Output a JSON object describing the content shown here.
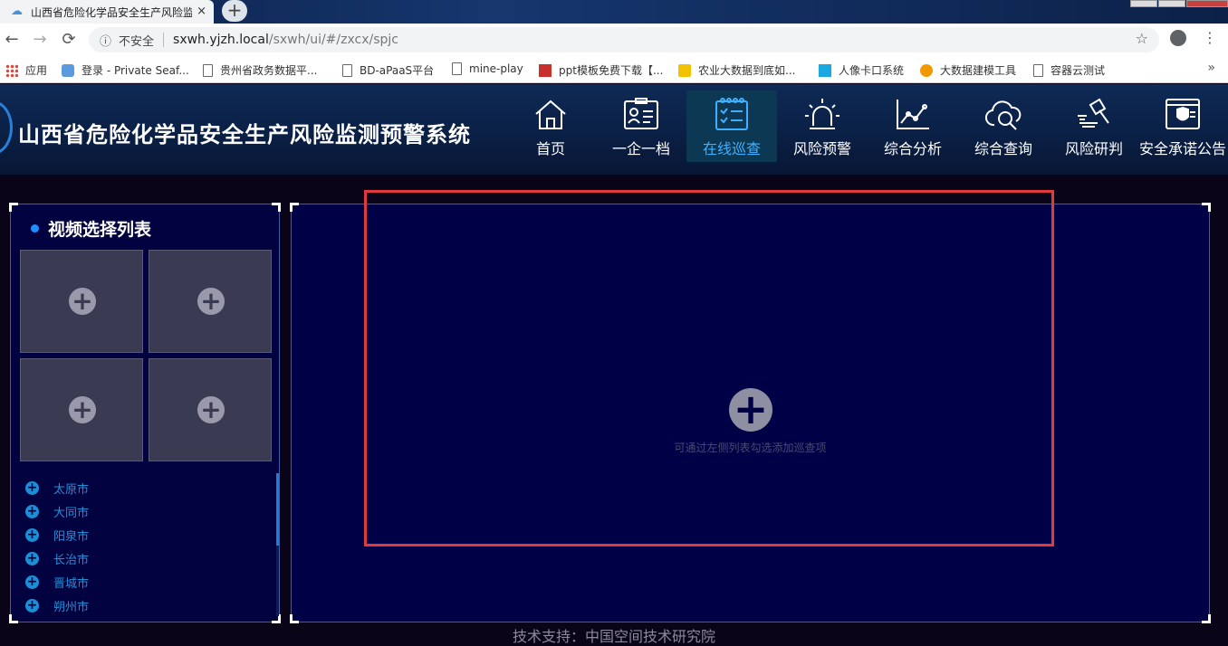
{
  "browser": {
    "tab_title": "山西省危险化学品安全生产风险监测",
    "tab_close": "×",
    "newtab": "+",
    "back": "←",
    "forward": "→",
    "reload": "⟳",
    "info_glyph": "ⓘ",
    "insecure": "不安全",
    "url_host": "sxwh.yjzh.local",
    "url_path": "/sxwh/ui/#/zxcx/spjc",
    "star": "☆",
    "menu": "⋮",
    "bookmarks_more": "»",
    "bookmarks": [
      {
        "label": "应用",
        "icon": "apps-grid-icon"
      },
      {
        "label": "登录 - Private Seaf...",
        "icon": "seafile-icon"
      },
      {
        "label": "贵州省政务数据平...",
        "icon": "page-icon"
      },
      {
        "label": "BD-aPaaS平台",
        "icon": "page-icon"
      },
      {
        "label": "mine-play",
        "icon": "page-icon"
      },
      {
        "label": "ppt模板免费下载【...",
        "icon": "ppt-icon"
      },
      {
        "label": "农业大数据到底如...",
        "icon": "sohu-icon"
      },
      {
        "label": "人像卡口系统",
        "icon": "camera-icon"
      },
      {
        "label": "大数据建模工具",
        "icon": "cloud-icon"
      },
      {
        "label": "容器云测试",
        "icon": "page-icon"
      }
    ]
  },
  "app": {
    "title": "山西省危险化学品安全生产风险监测预警系统",
    "nav": [
      {
        "label": "首页",
        "icon": "home-icon",
        "active": false
      },
      {
        "label": "一企一档",
        "icon": "id-card-icon",
        "active": false
      },
      {
        "label": "在线巡查",
        "icon": "checklist-icon",
        "active": true
      },
      {
        "label": "风险预警",
        "icon": "alarm-light-icon",
        "active": false
      },
      {
        "label": "综合分析",
        "icon": "line-chart-icon",
        "active": false
      },
      {
        "label": "综合查询",
        "icon": "cloud-search-icon",
        "active": false
      },
      {
        "label": "风险研判",
        "icon": "gavel-icon",
        "active": false
      },
      {
        "label": "安全承诺公告",
        "icon": "shield-doc-icon",
        "active": false
      }
    ],
    "accent": "#3fb0ff"
  },
  "left_panel": {
    "title": "视频选择列表",
    "slot_glyph": "+",
    "cities": [
      "太原市",
      "大同市",
      "阳泉市",
      "长治市",
      "晋城市",
      "朔州市"
    ]
  },
  "main_panel": {
    "plus_glyph": "+",
    "hint": "可通过左侧列表勾选添加巡查项"
  },
  "footer": {
    "text": "技术支持：中国空间技术研究院"
  }
}
